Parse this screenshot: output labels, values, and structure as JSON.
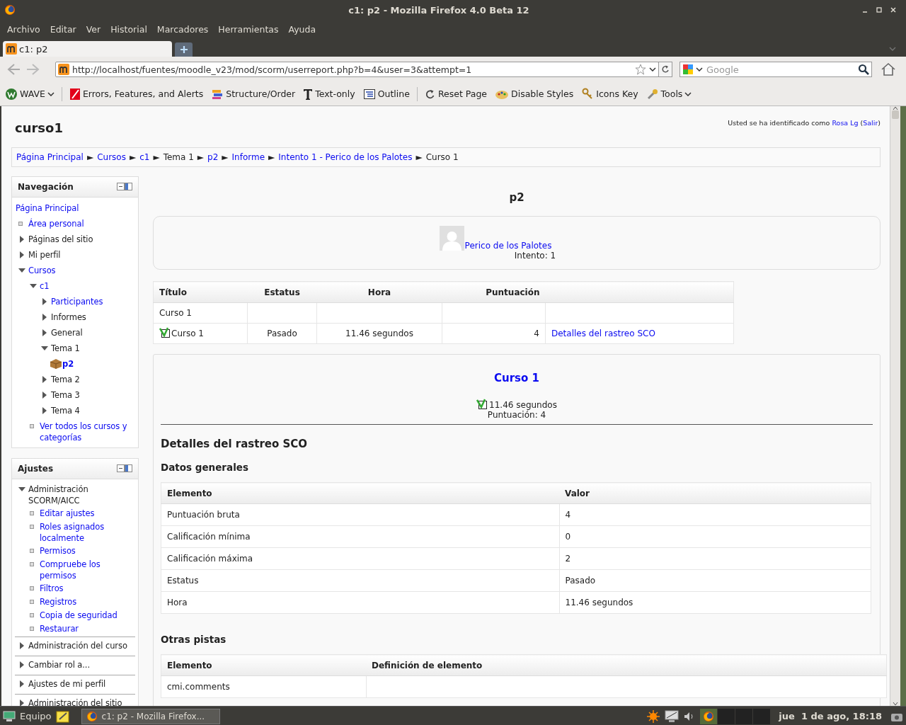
{
  "window": {
    "title": "c1: p2 - Mozilla Firefox 4.0 Beta 12"
  },
  "menu": [
    "Archivo",
    "Editar",
    "Ver",
    "Historial",
    "Marcadores",
    "Herramientas",
    "Ayuda"
  ],
  "tabs": [
    {
      "label": "c1: p2",
      "selected": true
    }
  ],
  "address_bar": {
    "url": "http://localhost/fuentes/moodle_v23/mod/scorm/userreport.php?b=4&user=3&attempt=1"
  },
  "search": {
    "placeholder": "Google"
  },
  "toolbar": [
    {
      "label": "WAVE",
      "kind": "wave",
      "dropdown": true
    },
    {
      "label": "Errors, Features, and Alerts",
      "kind": "errors",
      "dropdown": false
    },
    {
      "label": "Structure/Order",
      "kind": "structure",
      "dropdown": false
    },
    {
      "label": "Text-only",
      "kind": "text",
      "dropdown": false
    },
    {
      "label": "Outline",
      "kind": "outline",
      "dropdown": false
    },
    {
      "label": "Reset Page",
      "kind": "reset",
      "dropdown": false
    },
    {
      "label": "Disable Styles",
      "kind": "styles",
      "dropdown": false
    },
    {
      "label": "Icons Key",
      "kind": "key",
      "dropdown": false
    },
    {
      "label": "Tools",
      "kind": "tools",
      "dropdown": true
    }
  ],
  "page": {
    "site_title": "curso1",
    "login": {
      "prefix": "Usted se ha identificado como",
      "user": "Rosa Lg",
      "open": "(",
      "logout": "Salir",
      "close": ")"
    },
    "breadcrumb": [
      {
        "label": "Página Principal",
        "link": true,
        "separator": "►"
      },
      {
        "label": "Cursos",
        "link": true,
        "separator": "►"
      },
      {
        "label": "c1",
        "link": true,
        "separator": "►"
      },
      {
        "label": "Tema 1",
        "link": false,
        "separator": "►"
      },
      {
        "label": "p2",
        "link": true,
        "separator": "►"
      },
      {
        "label": "Informe",
        "link": true,
        "separator": "►"
      },
      {
        "label": "Intento 1 - Perico de los Palotes",
        "link": true,
        "separator": "►"
      },
      {
        "label": "Curso 1",
        "link": false
      }
    ]
  },
  "navigation": {
    "title": "Navegación",
    "items": [
      {
        "label": "Página Principal",
        "kind": "plain",
        "link": true
      },
      {
        "label": "Área personal",
        "kind": "leaf",
        "link": true
      },
      {
        "label": "Páginas del sitio",
        "kind": "branch",
        "link": false,
        "expanded": false
      },
      {
        "label": "Mi perfil",
        "kind": "branch",
        "link": false,
        "expanded": false
      },
      {
        "label": "Cursos",
        "kind": "branch",
        "link": true,
        "expanded": true,
        "children": [
          {
            "label": "c1",
            "kind": "branch",
            "link": true,
            "expanded": true,
            "children": [
              {
                "label": "Participantes",
                "kind": "branch",
                "link": true,
                "expanded": false
              },
              {
                "label": "Informes",
                "kind": "branch",
                "link": false,
                "expanded": false
              },
              {
                "label": "General",
                "kind": "branch",
                "link": false,
                "expanded": false
              },
              {
                "label": "Tema 1",
                "kind": "branch",
                "link": false,
                "expanded": true,
                "children": [
                  {
                    "label": "p2",
                    "kind": "activity",
                    "link": true
                  }
                ]
              },
              {
                "label": "Tema 2",
                "kind": "branch",
                "link": false,
                "expanded": false
              },
              {
                "label": "Tema 3",
                "kind": "branch",
                "link": false,
                "expanded": false
              },
              {
                "label": "Tema 4",
                "kind": "branch",
                "link": false,
                "expanded": false
              }
            ]
          },
          {
            "label": "Ver todos los cursos y categorías",
            "kind": "leaf",
            "link": true
          }
        ]
      }
    ]
  },
  "settings": {
    "title": "Ajustes",
    "items": [
      {
        "label": "Administración SCORM/AICC",
        "kind": "branch",
        "link": false,
        "expanded": true,
        "children": [
          {
            "label": "Editar ajustes",
            "kind": "leaf",
            "link": true
          },
          {
            "label": "Roles asignados localmente",
            "kind": "leaf",
            "link": true
          },
          {
            "label": "Permisos",
            "kind": "leaf",
            "link": true
          },
          {
            "label": "Compruebe los permisos",
            "kind": "leaf",
            "link": true
          },
          {
            "label": "Filtros",
            "kind": "leaf",
            "link": true
          },
          {
            "label": "Registros",
            "kind": "leaf",
            "link": true
          },
          {
            "label": "Copia de seguridad",
            "kind": "leaf",
            "link": true
          },
          {
            "label": "Restaurar",
            "kind": "leaf",
            "link": true
          }
        ]
      },
      {
        "label": "Administración del curso",
        "kind": "branch",
        "link": false,
        "expanded": false
      },
      {
        "label": "Cambiar rol a...",
        "kind": "branch",
        "link": false,
        "expanded": false
      },
      {
        "label": "Ajustes de mi perfil",
        "kind": "branch",
        "link": false,
        "expanded": false
      },
      {
        "label": "Administración del sitio",
        "kind": "branch",
        "link": false,
        "expanded": false
      }
    ]
  },
  "main": {
    "heading": "p2",
    "user": {
      "name": "Perico de los Palotes",
      "attempt": "Intento: 1"
    },
    "report_table": {
      "columns": [
        "Título",
        "Estatus",
        "Hora",
        "Puntuación"
      ],
      "rows": [
        {
          "title": "Curso 1",
          "completed": false
        },
        {
          "title": "Curso 1",
          "completed": true,
          "status": "Pasado",
          "time": "11.46 segundos",
          "score": "4",
          "link": "Detalles del rastreo SCO"
        }
      ]
    },
    "sco": {
      "title": "Curso 1",
      "completed": true,
      "time": "11.46 segundos",
      "score": "Puntuación: 4",
      "details_heading": "Detalles del rastreo SCO",
      "general_heading": "Datos generales",
      "general_table": {
        "columns": [
          "Elemento",
          "Valor"
        ],
        "rows": [
          [
            "Puntuación bruta",
            "4"
          ],
          [
            "Calificación mínima",
            "0"
          ],
          [
            "Calificación máxima",
            "2"
          ],
          [
            "Estatus",
            "Pasado"
          ],
          [
            "Hora",
            "11.46 segundos"
          ]
        ]
      },
      "other_heading": "Otras pistas",
      "other_table": {
        "columns": [
          "Elemento",
          "Definición de elemento"
        ],
        "rows": [
          [
            "cmi.comments"
          ]
        ]
      }
    }
  },
  "taskbar": {
    "start": "Equipo",
    "windows": [
      {
        "label": "c1: p2 - Mozilla Firefox...",
        "selected": false
      }
    ],
    "clock": "jue  1 de ago, 18:18"
  }
}
